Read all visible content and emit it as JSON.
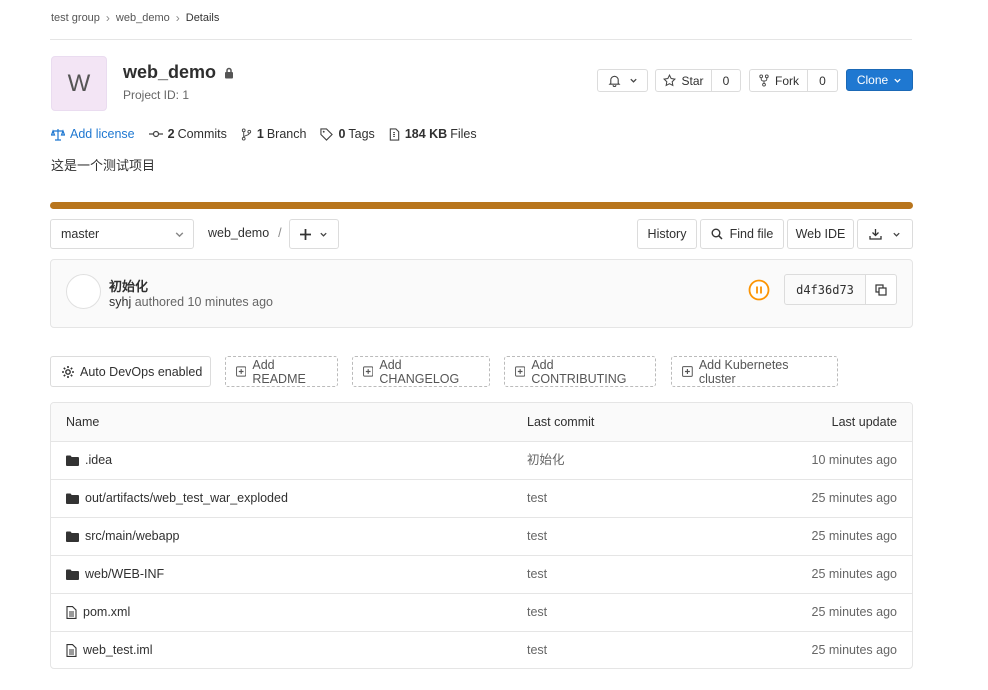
{
  "breadcrumb": [
    "test group",
    "web_demo",
    "Details"
  ],
  "project": {
    "avatar_letter": "W",
    "name": "web_demo",
    "id_text": "Project ID: 1",
    "description": "这是一个测试项目"
  },
  "actions": {
    "star_label": "Star",
    "star_count": "0",
    "fork_label": "Fork",
    "fork_count": "0",
    "clone_label": "Clone"
  },
  "stats": {
    "license": "Add license",
    "commits_count": "2",
    "commits_label": "Commits",
    "branch_count": "1",
    "branch_label": "Branch",
    "tags_count": "0",
    "tags_label": "Tags",
    "files_size": "184 KB",
    "files_label": "Files"
  },
  "toolbar": {
    "branch": "master",
    "path_root": "web_demo",
    "path_sep": "/",
    "history": "History",
    "find_file": "Find file",
    "web_ide": "Web IDE"
  },
  "last_commit": {
    "title": "初始化",
    "author": "syhj",
    "meta": "authored 10 minutes ago",
    "sha": "d4f36d73"
  },
  "quick_actions": {
    "devops": "Auto DevOps enabled",
    "readme": "Add README",
    "changelog": "Add CHANGELOG",
    "contributing": "Add CONTRIBUTING",
    "kubernetes": "Add Kubernetes cluster"
  },
  "table": {
    "headers": [
      "Name",
      "Last commit",
      "Last update"
    ],
    "rows": [
      {
        "type": "folder",
        "name": ".idea",
        "commit": "初始化",
        "date": "10 minutes ago"
      },
      {
        "type": "folder",
        "name": "out/artifacts/web_test_war_exploded",
        "commit": "test",
        "date": "25 minutes ago"
      },
      {
        "type": "folder",
        "name": "src/main/webapp",
        "commit": "test",
        "date": "25 minutes ago"
      },
      {
        "type": "folder",
        "name": "web/WEB-INF",
        "commit": "test",
        "date": "25 minutes ago"
      },
      {
        "type": "file",
        "name": "pom.xml",
        "commit": "test",
        "date": "25 minutes ago"
      },
      {
        "type": "file",
        "name": "web_test.iml",
        "commit": "test",
        "date": "25 minutes ago"
      }
    ]
  },
  "colors": {
    "accent": "#1f78d1",
    "progress": "#b8751d",
    "pipeline": "#fc9403",
    "avatar_bg": "#f3e5f5"
  }
}
